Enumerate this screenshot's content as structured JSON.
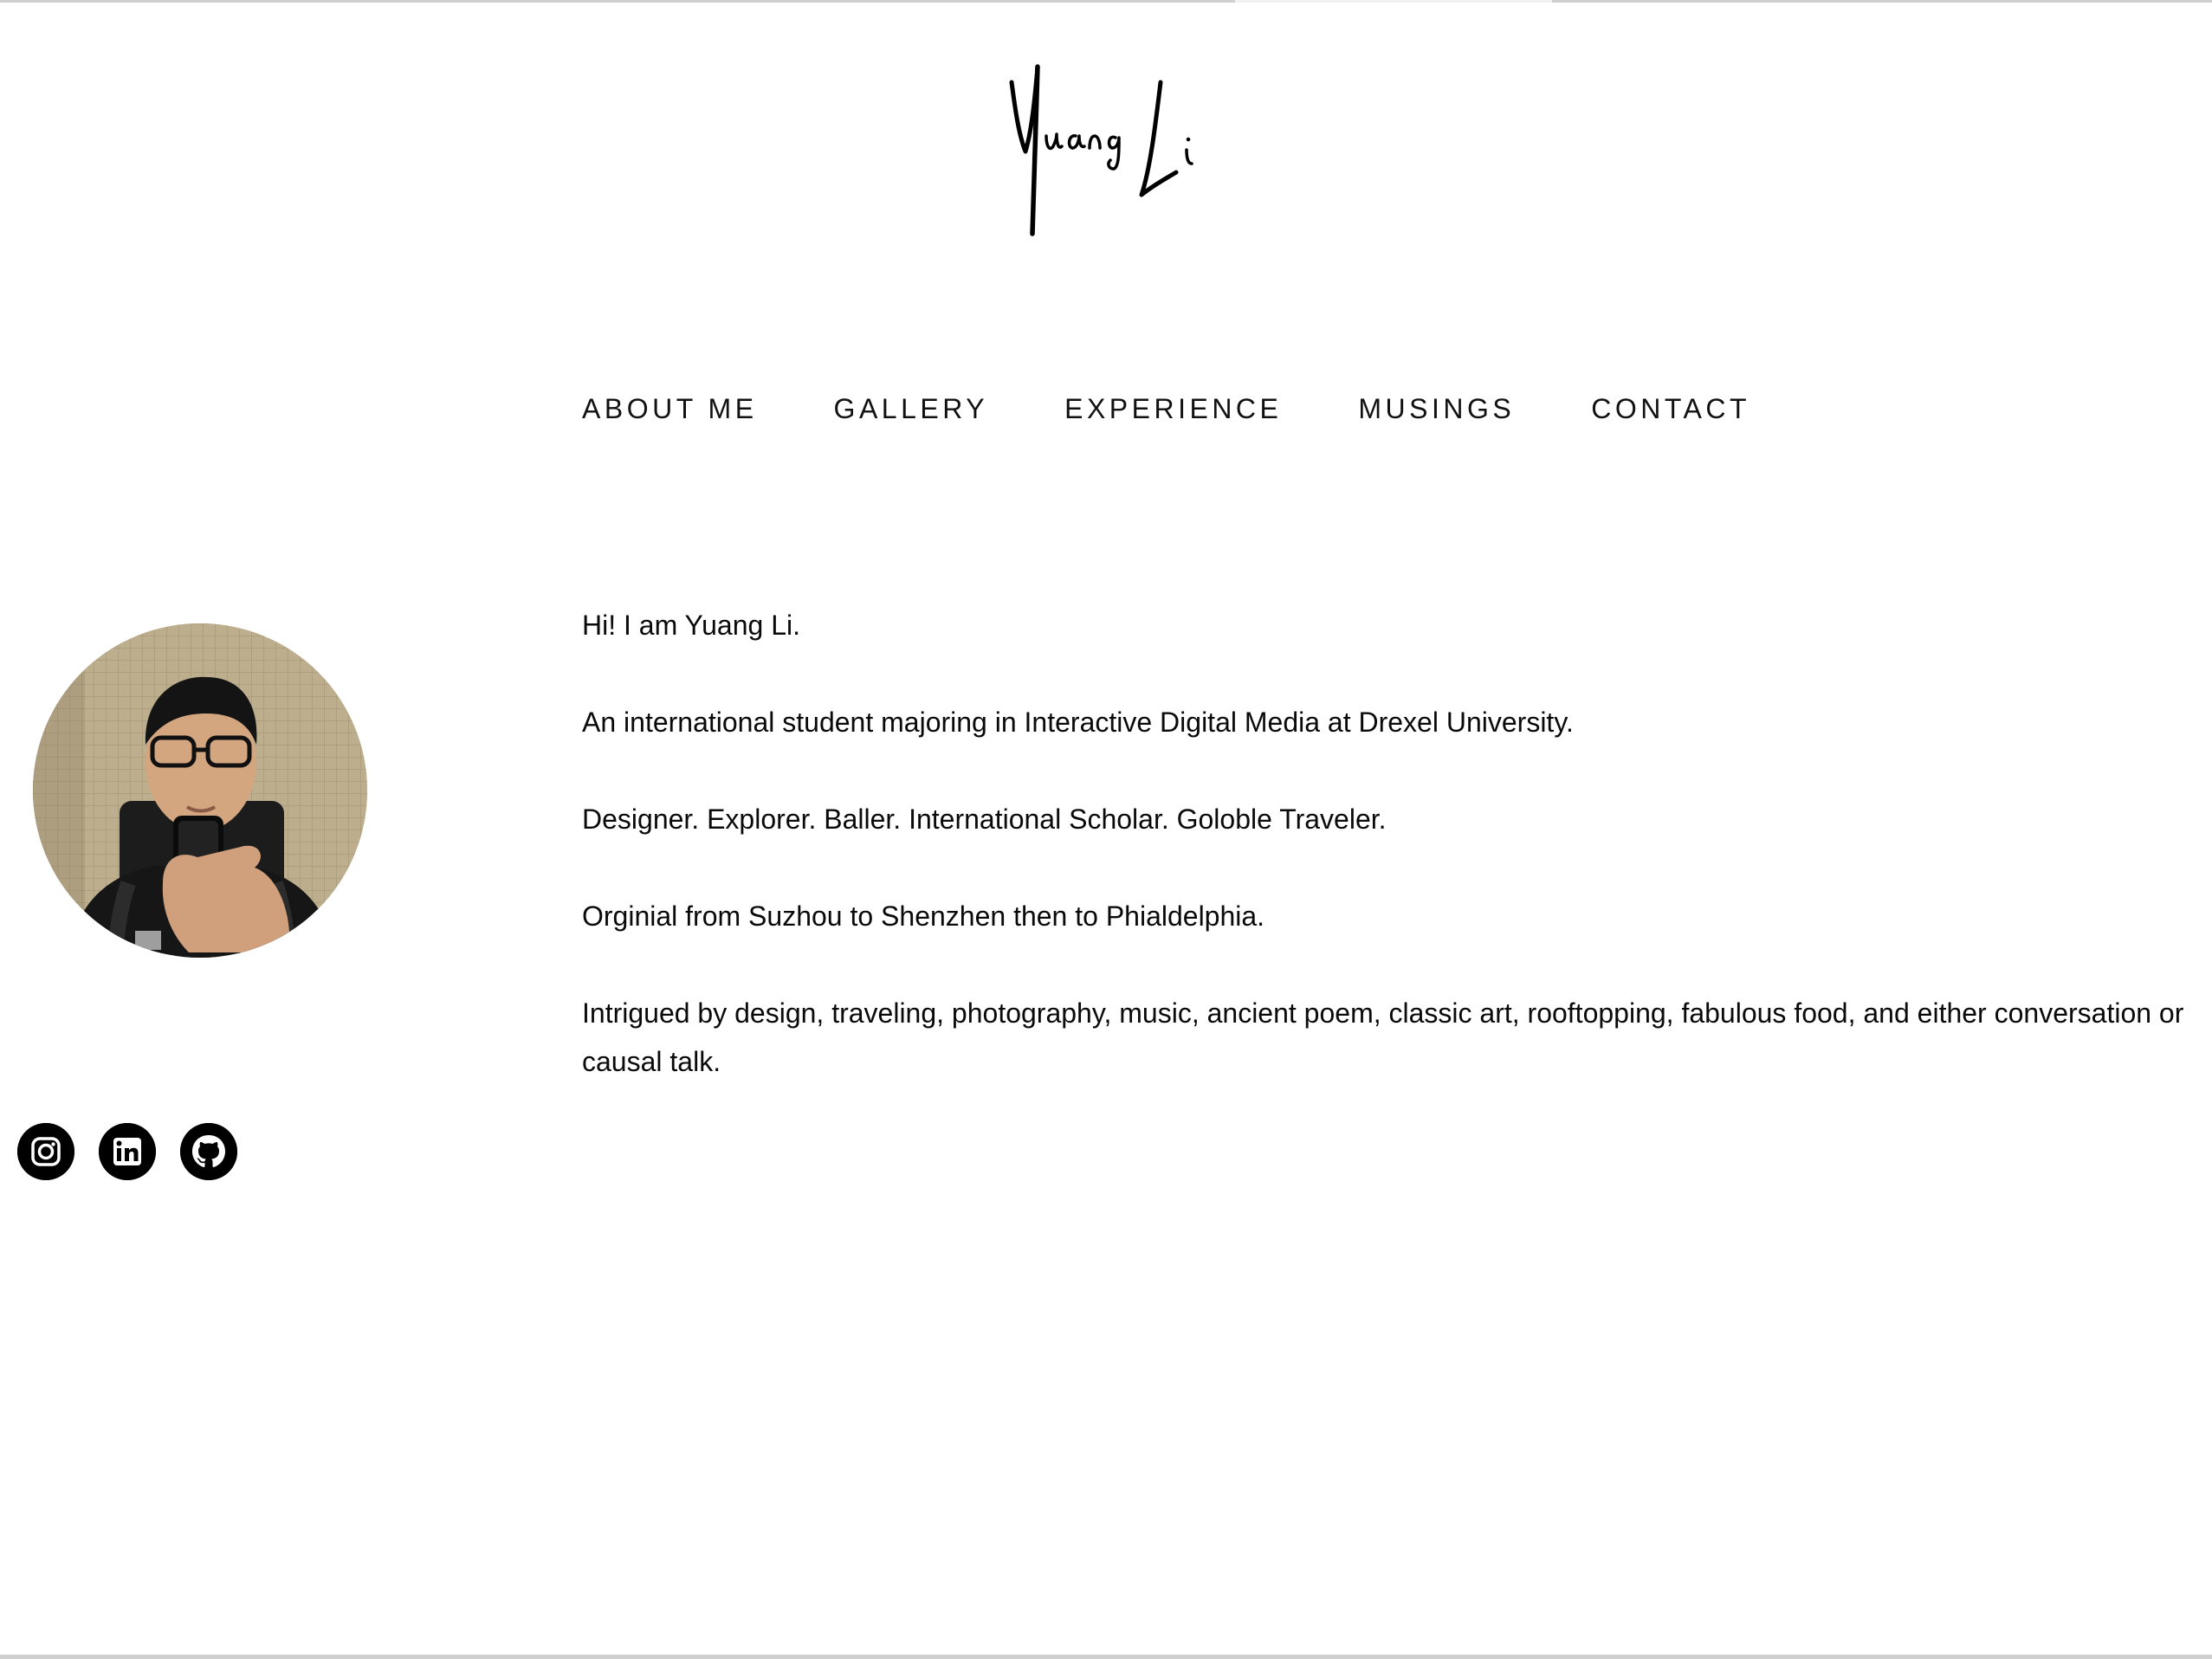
{
  "site": {
    "logo_text": "Yuang Li"
  },
  "nav": {
    "items": [
      {
        "label": "ABOUT ME"
      },
      {
        "label": "GALLERY"
      },
      {
        "label": "EXPERIENCE"
      },
      {
        "label": "MUSINGS"
      },
      {
        "label": "CONTACT"
      }
    ]
  },
  "profile": {
    "avatar_icon": "profile-photo"
  },
  "bio": {
    "greeting": "Hi! I am Yuang Li.",
    "line1": "An international student majoring in Interactive Digital Media at Drexel University.",
    "line2": "Designer. Explorer. Baller. International Scholar. Goloble Traveler.",
    "line3": "Orginial from Suzhou to Shenzhen then to Phialdelphia.",
    "line4": "Intrigued by design, traveling, photography, music, ancient poem, classic art, rooftopping, fabulous food, and either conversation or causal talk."
  },
  "social": {
    "icons": [
      "instagram-icon",
      "linkedin-icon",
      "github-icon"
    ]
  },
  "colors": {
    "text": "#0a0a0a",
    "background": "#ffffff",
    "icon_bg": "#000000"
  }
}
